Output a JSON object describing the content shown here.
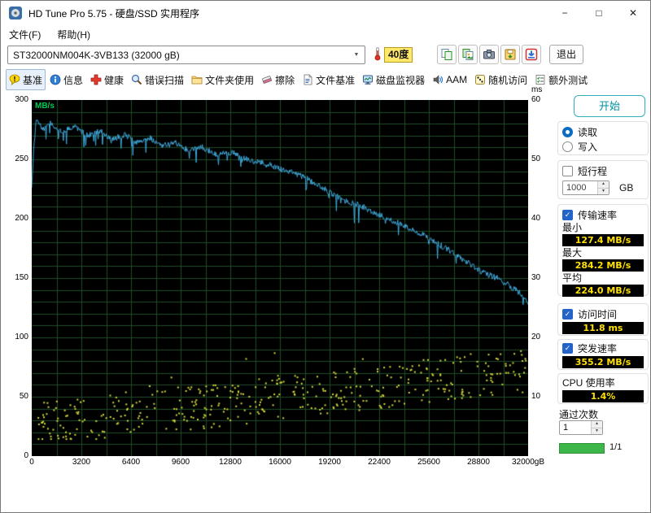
{
  "window": {
    "title": "HD Tune Pro 5.75 - 硬盘/SSD 实用程序",
    "controls": {
      "minimize": "−",
      "maximize": "□",
      "close": "✕"
    }
  },
  "menu": {
    "items": [
      {
        "id": "file",
        "label": "文件(F)"
      },
      {
        "id": "help",
        "label": "帮助(H)"
      }
    ]
  },
  "toolbar": {
    "drive_select": "ST32000NM004K-3VB133 (32000 gB)",
    "temperature": "40度",
    "exit_label": "退出",
    "buttons": [
      {
        "id": "copy-info",
        "icon": "copy-info-icon"
      },
      {
        "id": "copy-image",
        "icon": "copy-image-icon"
      },
      {
        "id": "screenshot",
        "icon": "camera-icon"
      },
      {
        "id": "save",
        "icon": "save-icon"
      },
      {
        "id": "download",
        "icon": "download-icon"
      }
    ]
  },
  "tabs": [
    {
      "id": "benchmark",
      "label": "基准",
      "icon": "benchmark-icon",
      "selected": true
    },
    {
      "id": "info",
      "label": "信息",
      "icon": "info-icon",
      "selected": false
    },
    {
      "id": "health",
      "label": "健康",
      "icon": "health-icon",
      "selected": false
    },
    {
      "id": "error-scan",
      "label": "错误扫描",
      "icon": "error-scan-icon",
      "selected": false
    },
    {
      "id": "folder-usage",
      "label": "文件夹使用",
      "icon": "folder-usage-icon",
      "selected": false
    },
    {
      "id": "erase",
      "label": "擦除",
      "icon": "erase-icon",
      "selected": false
    },
    {
      "id": "file-benchmark",
      "label": "文件基准",
      "icon": "file-benchmark-icon",
      "selected": false
    },
    {
      "id": "disk-monitor",
      "label": "磁盘监视器",
      "icon": "disk-monitor-icon",
      "selected": false
    },
    {
      "id": "aam",
      "label": "AAM",
      "icon": "aam-icon",
      "selected": false
    },
    {
      "id": "random-access",
      "label": "随机访问",
      "icon": "random-access-icon",
      "selected": false
    },
    {
      "id": "extra-tests",
      "label": "额外测试",
      "icon": "extra-tests-icon",
      "selected": false
    }
  ],
  "chart_data": {
    "type": "line+scatter",
    "left_axis": {
      "label": "MB/s",
      "ticks": [
        "300",
        "250",
        "200",
        "150",
        "100",
        "50",
        "0"
      ],
      "range": [
        0,
        300
      ]
    },
    "right_axis": {
      "label": "ms",
      "ticks": [
        "60",
        "50",
        "40",
        "30",
        "20",
        "10"
      ],
      "range": [
        0,
        60
      ]
    },
    "x_ticks": [
      "0",
      "3200",
      "6400",
      "9600",
      "12800",
      "16000",
      "19200",
      "22400",
      "25600",
      "28800",
      "32000gB"
    ],
    "x_range": [
      0,
      32000
    ],
    "grid": {
      "x_step": 1600,
      "y_step_mbps": 10,
      "color": "#1f4a26"
    },
    "transfer_rate_series": {
      "name": "读取传输速率",
      "color": "#3fa9dc",
      "unit": "MB/s",
      "keypoints": [
        [
          0,
          226
        ],
        [
          120,
          260
        ],
        [
          300,
          284
        ],
        [
          700,
          275
        ],
        [
          1200,
          280
        ],
        [
          2000,
          274
        ],
        [
          2800,
          278
        ],
        [
          3600,
          270
        ],
        [
          4400,
          274
        ],
        [
          5200,
          267
        ],
        [
          6000,
          271
        ],
        [
          6800,
          264
        ],
        [
          7600,
          268
        ],
        [
          8400,
          261
        ],
        [
          9200,
          265
        ],
        [
          10000,
          258
        ],
        [
          11000,
          260
        ],
        [
          12000,
          254
        ],
        [
          13000,
          256
        ],
        [
          14000,
          249
        ],
        [
          15000,
          247
        ],
        [
          16000,
          242
        ],
        [
          17000,
          238
        ],
        [
          18000,
          232
        ],
        [
          19000,
          224
        ],
        [
          20000,
          216
        ],
        [
          21000,
          212
        ],
        [
          22000,
          206
        ],
        [
          23000,
          200
        ],
        [
          24000,
          194
        ],
        [
          25000,
          188
        ],
        [
          26000,
          180
        ],
        [
          27000,
          173
        ],
        [
          28000,
          164
        ],
        [
          29000,
          155
        ],
        [
          30000,
          150
        ],
        [
          31000,
          142
        ],
        [
          31600,
          136
        ],
        [
          32000,
          129
        ]
      ],
      "min": 127.4,
      "max": 284.2,
      "avg": 224.0
    },
    "access_time_scatter": {
      "name": "访问时间",
      "color": "#d2d83a",
      "unit": "ms",
      "count": 420,
      "ms_start": 5.2,
      "ms_end": 14.7,
      "ms_spread": 3.8,
      "noise_seed": 1337
    }
  },
  "panel": {
    "start_label": "开始",
    "read_label": "读取",
    "write_label": "写入",
    "short_stroke_label": "短行程",
    "short_stroke_value": "1000",
    "short_stroke_unit": "GB",
    "transfer_label": "传输速率",
    "min_label": "最小",
    "min_value": "127.4 MB/s",
    "max_label": "最大",
    "max_value": "284.2 MB/s",
    "avg_label": "平均",
    "avg_value": "224.0 MB/s",
    "access_label": "访问时间",
    "access_value": "11.8 ms",
    "burst_label": "突发速率",
    "burst_value": "355.2 MB/s",
    "cpu_label": "CPU 使用率",
    "cpu_value": "1.4%",
    "passes_label": "通过次数",
    "passes_value": "1",
    "progress_label": "1/1"
  }
}
